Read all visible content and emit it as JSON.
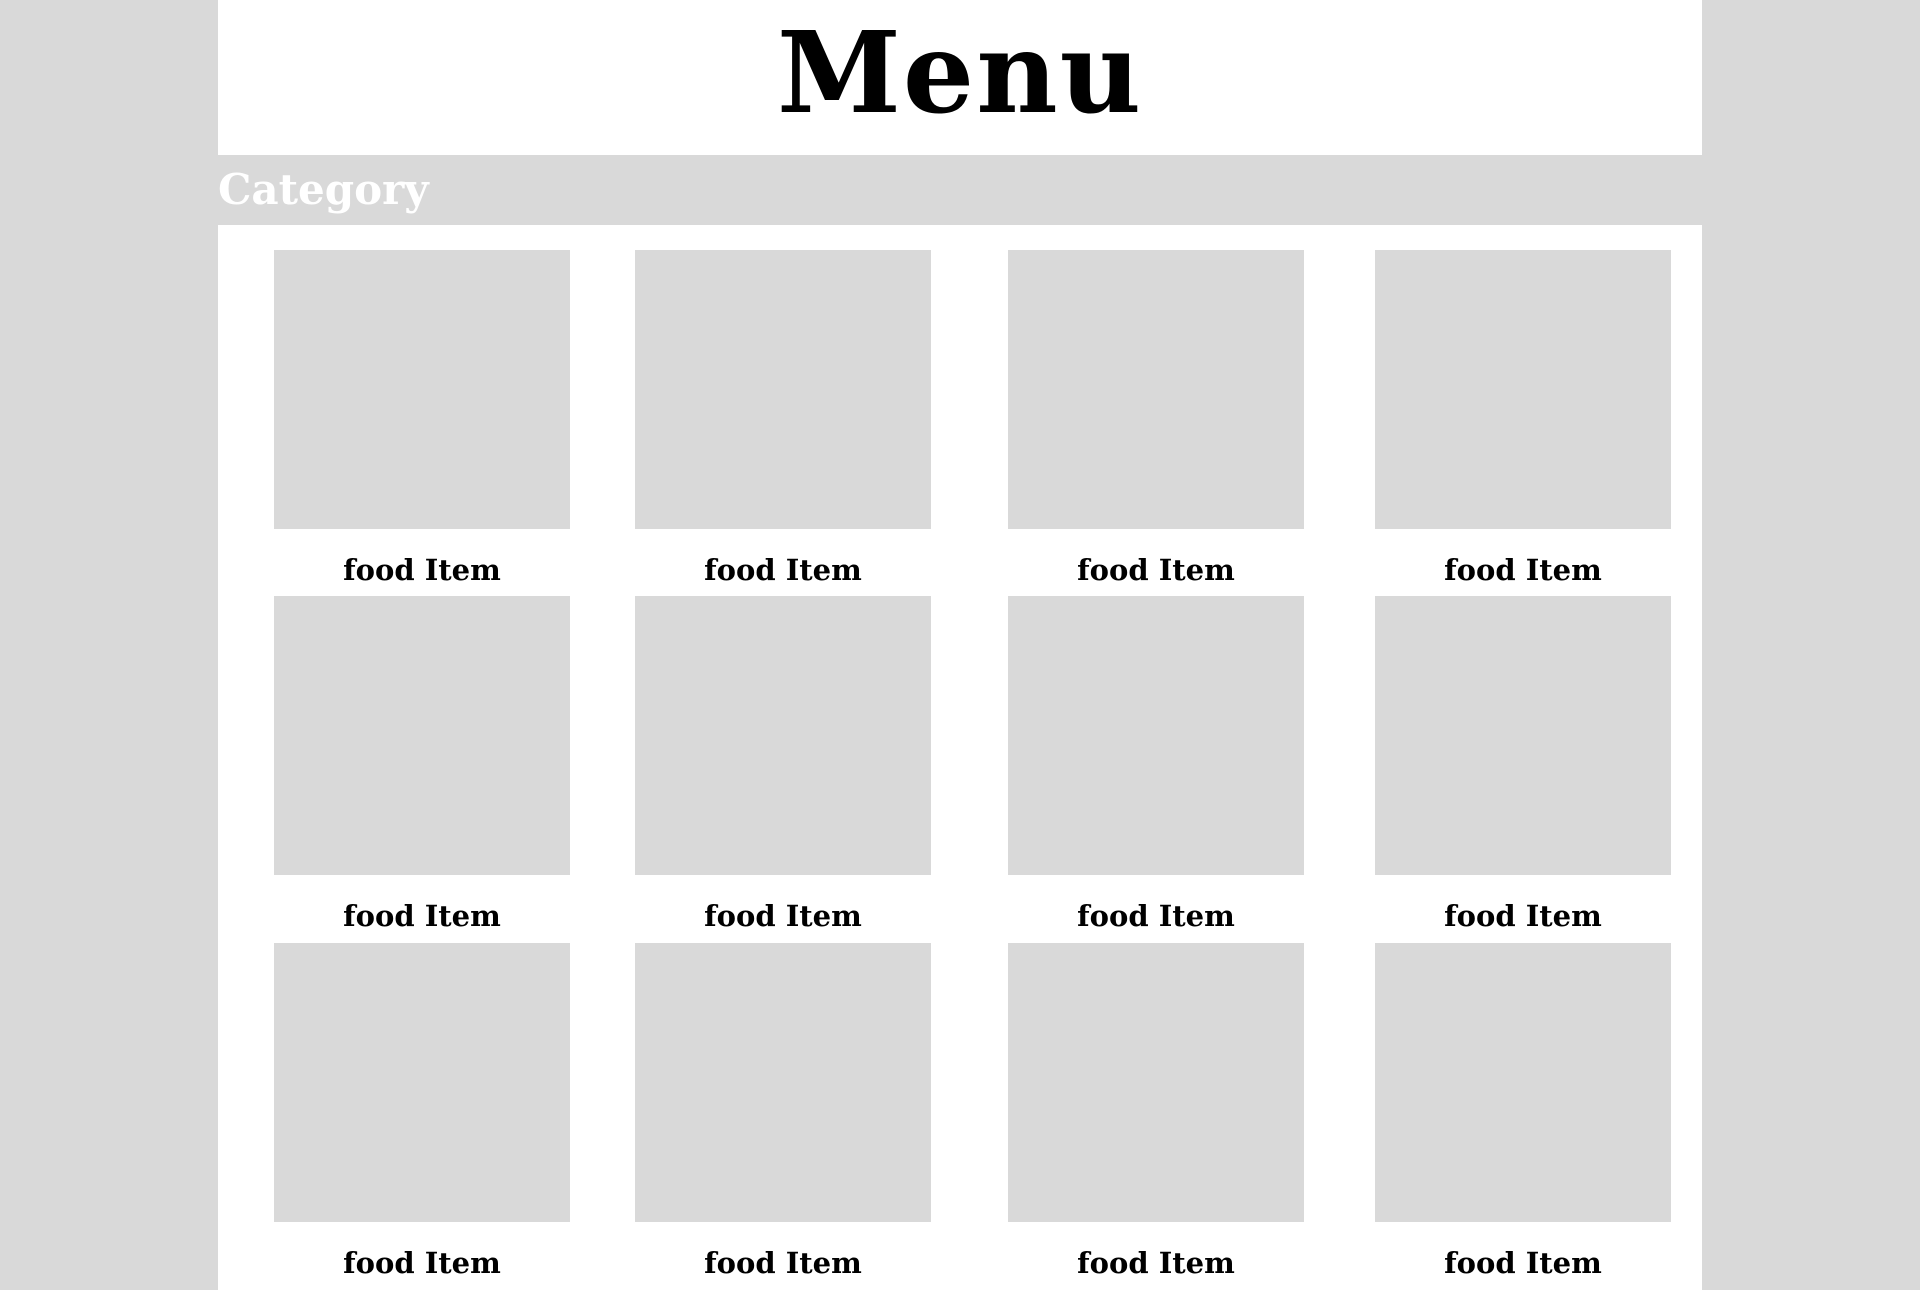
{
  "header": {
    "title": "Menu"
  },
  "category": {
    "label": "Category"
  },
  "items": [
    {
      "label": "food Item"
    },
    {
      "label": "food Item"
    },
    {
      "label": "food Item"
    },
    {
      "label": "food Item"
    },
    {
      "label": "food Item"
    },
    {
      "label": "food Item"
    },
    {
      "label": "food Item"
    },
    {
      "label": "food Item"
    },
    {
      "label": "food Item"
    },
    {
      "label": "food Item"
    },
    {
      "label": "food Item"
    },
    {
      "label": "food Item"
    }
  ],
  "colors": {
    "background": "#d9d9d9",
    "panel": "#ffffff",
    "placeholder": "#d9d9d9",
    "text": "#000000",
    "category_text": "#ffffff"
  }
}
